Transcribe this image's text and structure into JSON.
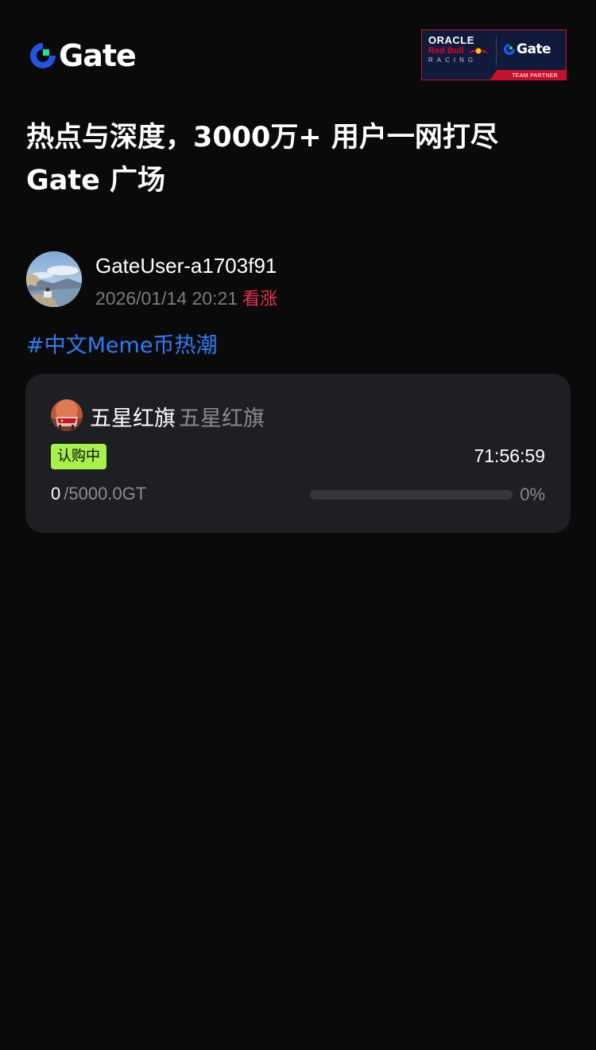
{
  "header": {
    "logo_text": "Gate",
    "partner_badge": {
      "oracle": "ORACLE",
      "redbull": "Red Bull",
      "racing": "RACING",
      "gate": "Gate",
      "team_partner": "TEAM PARTNER"
    }
  },
  "hero": {
    "title_line1": "热点与深度，3000万+ 用户一网打尽",
    "title_line2": "Gate 广场"
  },
  "post": {
    "username": "GateUser-a1703f91",
    "timestamp": "2026/01/14 20:21",
    "sentiment": "看涨",
    "hashtag": "#中文Meme币热潮"
  },
  "card": {
    "token_name": "五星红旗",
    "token_symbol": "五星红旗",
    "status": "认购中",
    "countdown": "71:56:59",
    "raised_value": "0",
    "raised_total": "/5000.0GT",
    "progress_percent": 0,
    "progress_label": "0%"
  },
  "colors": {
    "background": "#0a0a0a",
    "card_bg": "#1e1f22",
    "accent_green": "#a8f04a",
    "link_blue": "#2d7df6",
    "bullish_red": "#e8364e",
    "gate_blue": "#2354e6",
    "gate_green": "#17e6a1"
  }
}
